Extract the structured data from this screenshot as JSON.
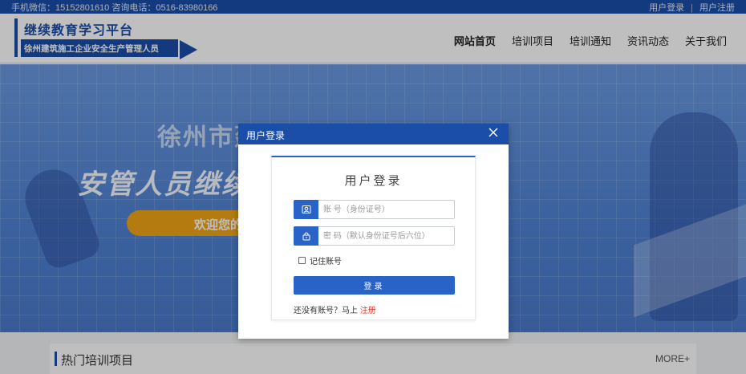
{
  "topbar": {
    "contact": "手机微信：15152801610  咨询电话：0516-83980166",
    "login": "用户登录",
    "separator": "|",
    "register": "用户注册"
  },
  "logo": {
    "title": "继续教育学习平台",
    "subtitle": "徐州建筑施工企业安全生产管理人员"
  },
  "nav": {
    "items": [
      {
        "label": "网站首页",
        "active": true
      },
      {
        "label": "培训项目",
        "active": false
      },
      {
        "label": "培训通知",
        "active": false
      },
      {
        "label": "资讯动态",
        "active": false
      },
      {
        "label": "关于我们",
        "active": false
      }
    ]
  },
  "banner": {
    "city_text": "徐州市建",
    "headline": "安管人员继续",
    "welcome": "欢迎您的"
  },
  "section": {
    "title": "热门培训项目",
    "more": "MORE+"
  },
  "modal": {
    "header_title": "用户登录",
    "close_icon": "close-icon",
    "card_title": "用户登录",
    "account_placeholder": "账 号（身份证号）",
    "password_placeholder": "密 码（默认身份证号后六位）",
    "remember_label": "记住账号",
    "login_button": "登录",
    "no_account_text": "还没有账号？马上",
    "register_link": "注册"
  },
  "colors": {
    "brand_blue": "#1a4ea8",
    "button_blue": "#2a63c8",
    "orange": "#f0a516",
    "link_red": "#e0392b"
  }
}
